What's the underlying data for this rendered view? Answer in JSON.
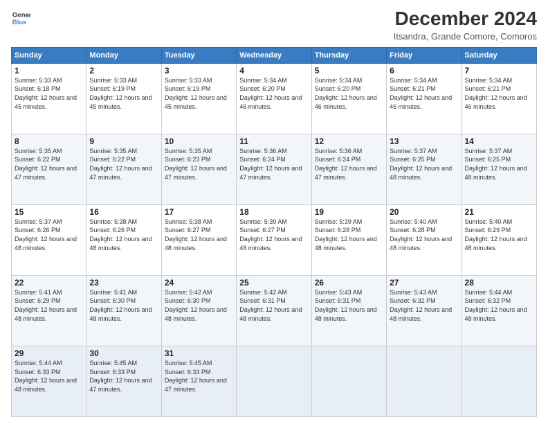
{
  "header": {
    "logo_line1": "General",
    "logo_line2": "Blue",
    "title": "December 2024",
    "subtitle": "Itsandra, Grande Comore, Comoros"
  },
  "days_of_week": [
    "Sunday",
    "Monday",
    "Tuesday",
    "Wednesday",
    "Thursday",
    "Friday",
    "Saturday"
  ],
  "weeks": [
    [
      {
        "day": "1",
        "sunrise": "5:33 AM",
        "sunset": "6:18 PM",
        "daylight": "12 hours and 45 minutes."
      },
      {
        "day": "2",
        "sunrise": "5:33 AM",
        "sunset": "6:19 PM",
        "daylight": "12 hours and 45 minutes."
      },
      {
        "day": "3",
        "sunrise": "5:33 AM",
        "sunset": "6:19 PM",
        "daylight": "12 hours and 45 minutes."
      },
      {
        "day": "4",
        "sunrise": "5:34 AM",
        "sunset": "6:20 PM",
        "daylight": "12 hours and 46 minutes."
      },
      {
        "day": "5",
        "sunrise": "5:34 AM",
        "sunset": "6:20 PM",
        "daylight": "12 hours and 46 minutes."
      },
      {
        "day": "6",
        "sunrise": "5:34 AM",
        "sunset": "6:21 PM",
        "daylight": "12 hours and 46 minutes."
      },
      {
        "day": "7",
        "sunrise": "5:34 AM",
        "sunset": "6:21 PM",
        "daylight": "12 hours and 46 minutes."
      }
    ],
    [
      {
        "day": "8",
        "sunrise": "5:35 AM",
        "sunset": "6:22 PM",
        "daylight": "12 hours and 47 minutes."
      },
      {
        "day": "9",
        "sunrise": "5:35 AM",
        "sunset": "6:22 PM",
        "daylight": "12 hours and 47 minutes."
      },
      {
        "day": "10",
        "sunrise": "5:35 AM",
        "sunset": "6:23 PM",
        "daylight": "12 hours and 47 minutes."
      },
      {
        "day": "11",
        "sunrise": "5:36 AM",
        "sunset": "6:24 PM",
        "daylight": "12 hours and 47 minutes."
      },
      {
        "day": "12",
        "sunrise": "5:36 AM",
        "sunset": "6:24 PM",
        "daylight": "12 hours and 47 minutes."
      },
      {
        "day": "13",
        "sunrise": "5:37 AM",
        "sunset": "6:25 PM",
        "daylight": "12 hours and 48 minutes."
      },
      {
        "day": "14",
        "sunrise": "5:37 AM",
        "sunset": "6:25 PM",
        "daylight": "12 hours and 48 minutes."
      }
    ],
    [
      {
        "day": "15",
        "sunrise": "5:37 AM",
        "sunset": "6:26 PM",
        "daylight": "12 hours and 48 minutes."
      },
      {
        "day": "16",
        "sunrise": "5:38 AM",
        "sunset": "6:26 PM",
        "daylight": "12 hours and 48 minutes."
      },
      {
        "day": "17",
        "sunrise": "5:38 AM",
        "sunset": "6:27 PM",
        "daylight": "12 hours and 48 minutes."
      },
      {
        "day": "18",
        "sunrise": "5:39 AM",
        "sunset": "6:27 PM",
        "daylight": "12 hours and 48 minutes."
      },
      {
        "day": "19",
        "sunrise": "5:39 AM",
        "sunset": "6:28 PM",
        "daylight": "12 hours and 48 minutes."
      },
      {
        "day": "20",
        "sunrise": "5:40 AM",
        "sunset": "6:28 PM",
        "daylight": "12 hours and 48 minutes."
      },
      {
        "day": "21",
        "sunrise": "5:40 AM",
        "sunset": "6:29 PM",
        "daylight": "12 hours and 48 minutes."
      }
    ],
    [
      {
        "day": "22",
        "sunrise": "5:41 AM",
        "sunset": "6:29 PM",
        "daylight": "12 hours and 48 minutes."
      },
      {
        "day": "23",
        "sunrise": "5:41 AM",
        "sunset": "6:30 PM",
        "daylight": "12 hours and 48 minutes."
      },
      {
        "day": "24",
        "sunrise": "5:42 AM",
        "sunset": "6:30 PM",
        "daylight": "12 hours and 48 minutes."
      },
      {
        "day": "25",
        "sunrise": "5:42 AM",
        "sunset": "6:31 PM",
        "daylight": "12 hours and 48 minutes."
      },
      {
        "day": "26",
        "sunrise": "5:43 AM",
        "sunset": "6:31 PM",
        "daylight": "12 hours and 48 minutes."
      },
      {
        "day": "27",
        "sunrise": "5:43 AM",
        "sunset": "6:32 PM",
        "daylight": "12 hours and 48 minutes."
      },
      {
        "day": "28",
        "sunrise": "5:44 AM",
        "sunset": "6:32 PM",
        "daylight": "12 hours and 48 minutes."
      }
    ],
    [
      {
        "day": "29",
        "sunrise": "5:44 AM",
        "sunset": "6:33 PM",
        "daylight": "12 hours and 48 minutes."
      },
      {
        "day": "30",
        "sunrise": "5:45 AM",
        "sunset": "6:33 PM",
        "daylight": "12 hours and 47 minutes."
      },
      {
        "day": "31",
        "sunrise": "5:45 AM",
        "sunset": "6:33 PM",
        "daylight": "12 hours and 47 minutes."
      },
      null,
      null,
      null,
      null
    ]
  ]
}
